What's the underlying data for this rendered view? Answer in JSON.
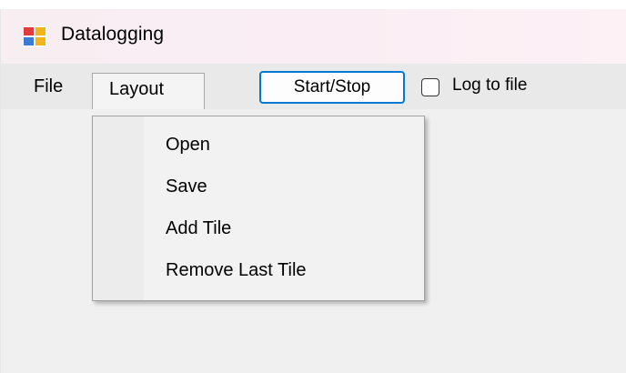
{
  "window": {
    "title": "Datalogging",
    "icon": "app-window-icon"
  },
  "menubar": {
    "items": [
      {
        "label": "File"
      },
      {
        "label": "Layout"
      }
    ]
  },
  "toolbar": {
    "start_stop_label": "Start/Stop",
    "log_to_file_label": "Log to file",
    "log_to_file_checked": false
  },
  "dropdown": {
    "items": [
      {
        "label": "Open"
      },
      {
        "label": "Save"
      },
      {
        "label": "Add Tile"
      },
      {
        "label": "Remove Last Tile"
      }
    ]
  },
  "colors": {
    "accent": "#0078d4",
    "menubar_bg": "#e9e9e9",
    "window_bg": "#f0f0f0"
  }
}
